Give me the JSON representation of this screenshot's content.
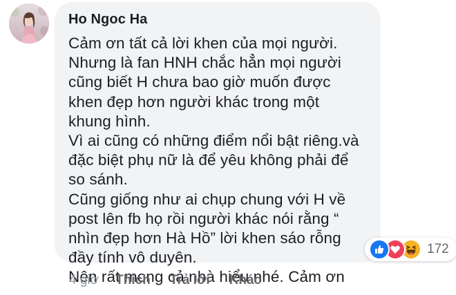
{
  "comment": {
    "author": "Ho Ngoc Ha",
    "lines": [
      "Cảm ơn tất cả lời khen của mọi người.",
      "Nhưng là fan HNH chắc hẳn mọi người",
      "cũng biết H chưa bao giờ muốn được",
      "khen đẹp hơn người khác trong một",
      "khung hình.",
      "Vì ai cũng có những điểm nổi bật riêng.và",
      "đặc biệt phụ nữ là để yêu không phải để",
      "so sánh.",
      "Cũng giống như ai chụp chung với H về",
      "post lên fb họ rồi người khác nói rằng “",
      "nhìn đẹp hơn Hà Hồ” lời khen sáo rỗng",
      "đầy tính vô duyên.",
      "Nên rất mong cả nhà hiểu nhé. Cảm ơn"
    ]
  },
  "reactions": {
    "icons": [
      "like-icon",
      "love-icon",
      "haha-icon"
    ],
    "count": "172",
    "colors": {
      "like": "#1877f2",
      "love": "#f33e58",
      "haha": "#f7b125"
    }
  },
  "actions": {
    "time": "4 giờ",
    "like_label": "Thích",
    "reply_label": "Trả lời",
    "more_label": "Khác"
  },
  "colors": {
    "bubble_bg": "#f2f3f5",
    "text": "#1c1e21",
    "meta": "#65676b",
    "time": "#8d949e"
  }
}
